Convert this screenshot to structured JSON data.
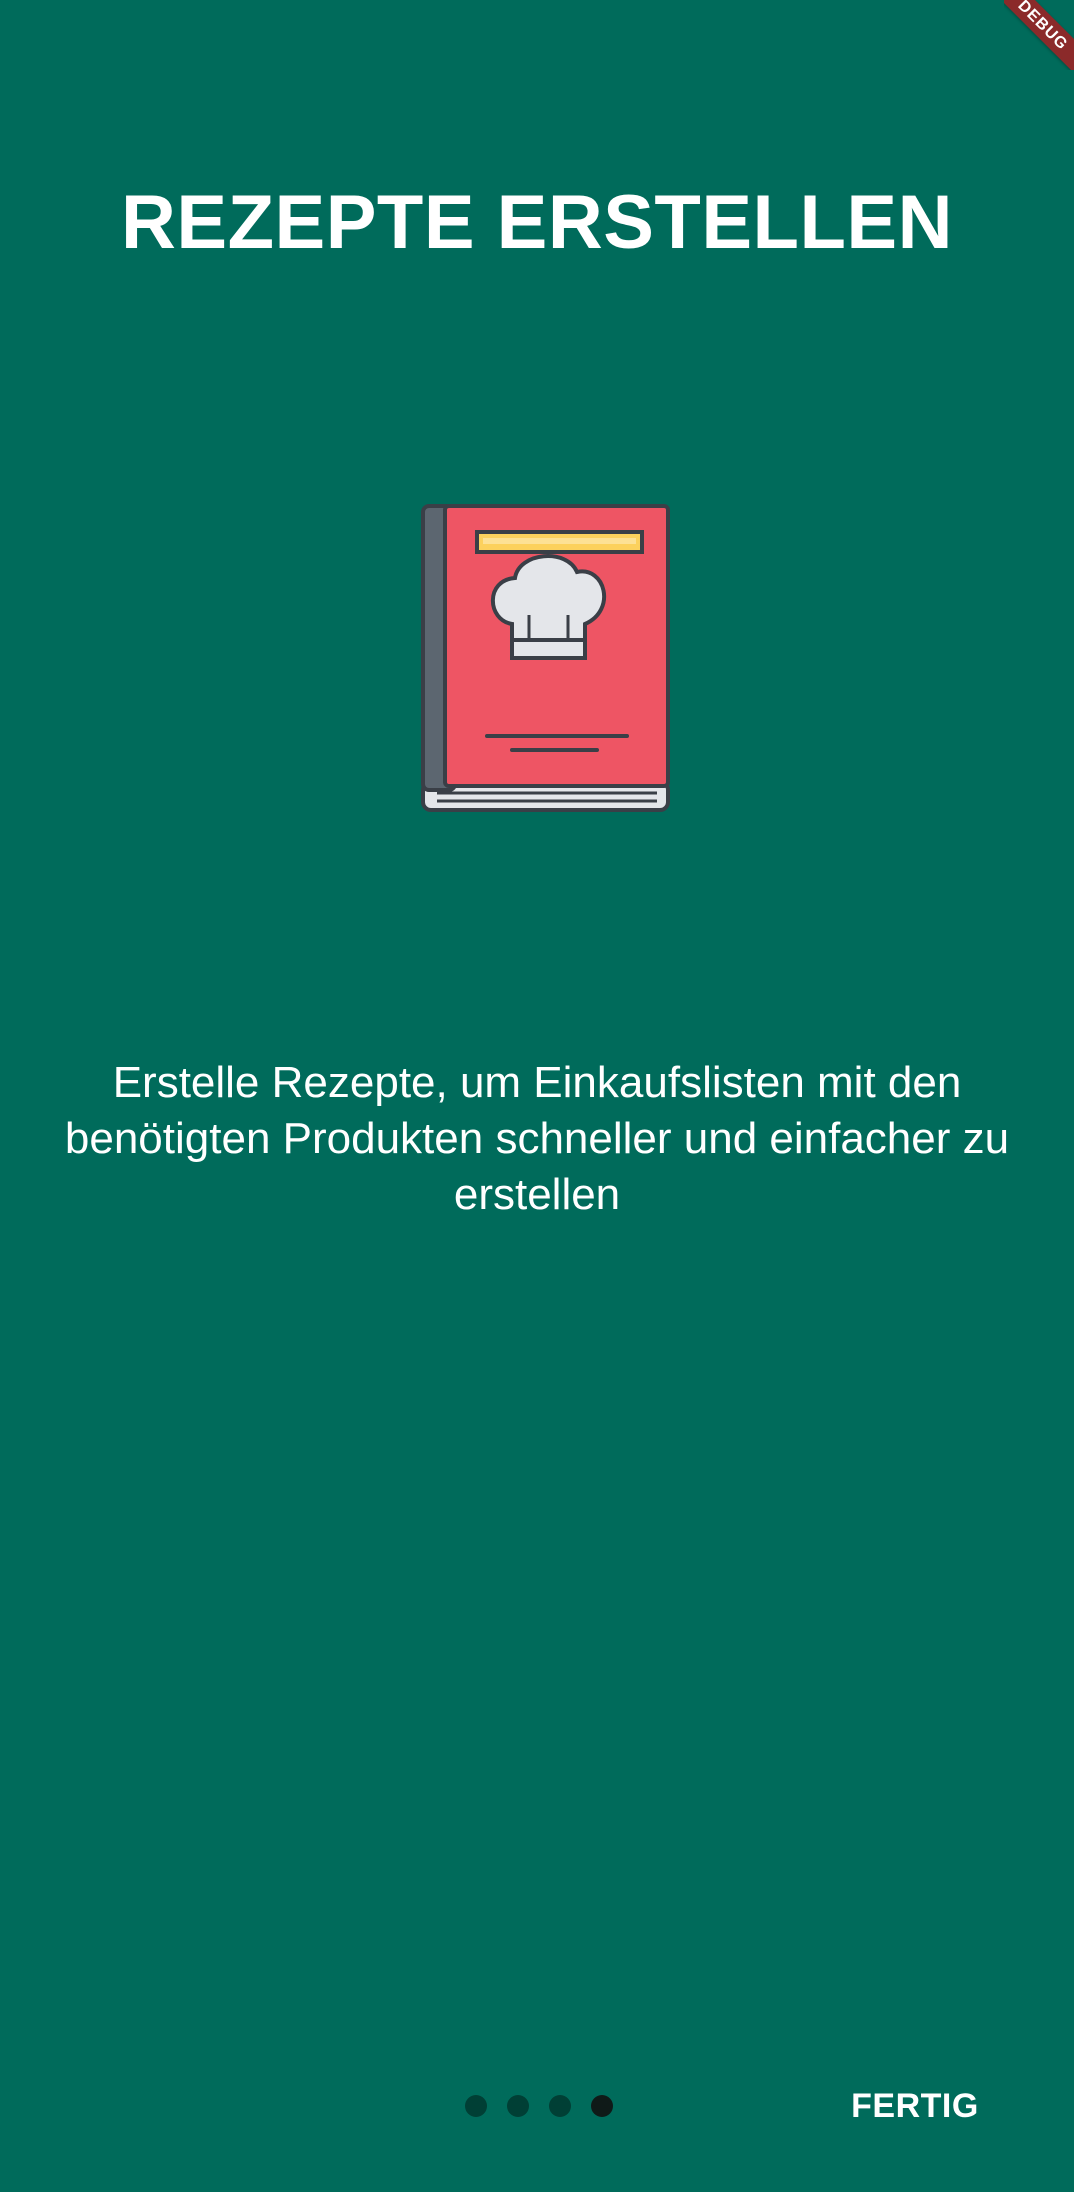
{
  "debug_banner": {
    "text": "DEBUG"
  },
  "onboarding": {
    "title": "REZEPTE ERSTELLEN",
    "description": "Erstelle Rezepte, um Einkaufslisten mit den benötigten Produkten schneller und einfacher zu erstellen",
    "illustration_icon": "cookbook-icon",
    "page_count": 4,
    "current_page": 4
  },
  "footer": {
    "done_label": "FERTIG"
  },
  "colors": {
    "background": "#006b5b",
    "dot_inactive": "#003f35",
    "dot_active": "#0f1a18",
    "book_cover": "#ee5564",
    "book_spine": "#5c6670",
    "book_label": "#fcd15d",
    "chef_hat": "#e4e6ea"
  }
}
